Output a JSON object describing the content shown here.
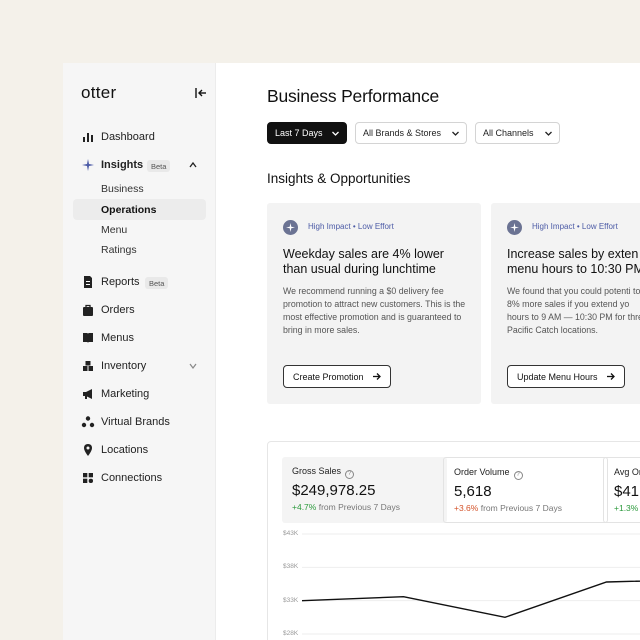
{
  "app": {
    "logo": "otter"
  },
  "sidebar": {
    "items": [
      {
        "label": "Dashboard",
        "icon": "bar-chart-icon"
      },
      {
        "label": "Insights",
        "icon": "sparkle-icon",
        "badge": "Beta"
      },
      {
        "label": "Reports",
        "icon": "document-icon",
        "badge": "Beta"
      },
      {
        "label": "Orders",
        "icon": "bag-icon"
      },
      {
        "label": "Menus",
        "icon": "book-icon"
      },
      {
        "label": "Inventory",
        "icon": "boxes-icon"
      },
      {
        "label": "Marketing",
        "icon": "megaphone-icon"
      },
      {
        "label": "Virtual Brands",
        "icon": "cluster-icon"
      },
      {
        "label": "Locations",
        "icon": "pin-icon"
      },
      {
        "label": "Connections",
        "icon": "grid-icon"
      }
    ],
    "insights_sub": [
      "Business",
      "Operations",
      "Menu",
      "Ratings"
    ],
    "active_sub": "Operations"
  },
  "main": {
    "title": "Business Performance",
    "filters": [
      "Last 7 Days",
      "All Brands & Stores",
      "All Channels"
    ],
    "section_title": "Insights & Opportunities",
    "cards": [
      {
        "tag": "High Impact • Low Effort",
        "title_line1": "Weekday sales are 4% lower",
        "title_line2": "than usual during lunchtime",
        "body": "We recommend running a $0 delivery fee promotion to attract new customers. This is the most effective promotion and is guaranteed to bring in more sales.",
        "cta": "Create Promotion"
      },
      {
        "tag": "High Impact • Low Effort",
        "title_line1": "Increase sales by exten",
        "title_line2": "menu hours to 10:30 PM",
        "body": "We found that you could potenti to 8% more sales if you extend yo hours to 9 AM — 10:30 PM for thre Pacific Catch locations.",
        "cta": "Update Menu Hours"
      }
    ],
    "stats": [
      {
        "label": "Gross Sales",
        "value": "$249,978.25",
        "delta": "+4.7%",
        "delta_sign": "pos",
        "compare": "from Previous 7 Days"
      },
      {
        "label": "Order Volume",
        "value": "5,618",
        "delta": "+3.6%",
        "delta_sign": "neg",
        "compare": "from Previous 7 Days"
      },
      {
        "label": "Avg Or",
        "value": "$41.",
        "delta": "+1.3%",
        "delta_sign": "pos",
        "compare": ""
      }
    ]
  },
  "chart_data": {
    "type": "line",
    "title": "",
    "xlabel": "",
    "ylabel": "",
    "yticks": [
      "$43K",
      "$38K",
      "$33K",
      "$28K"
    ],
    "ylim": [
      28000,
      43000
    ],
    "series": [
      {
        "values": [
          33000,
          33600,
          30500,
          35800,
          36200
        ]
      }
    ],
    "grid": true
  },
  "colors": {
    "accent_tag": "#4c5ba6",
    "positive": "#2c9a3c",
    "negative": "#d4532a"
  }
}
